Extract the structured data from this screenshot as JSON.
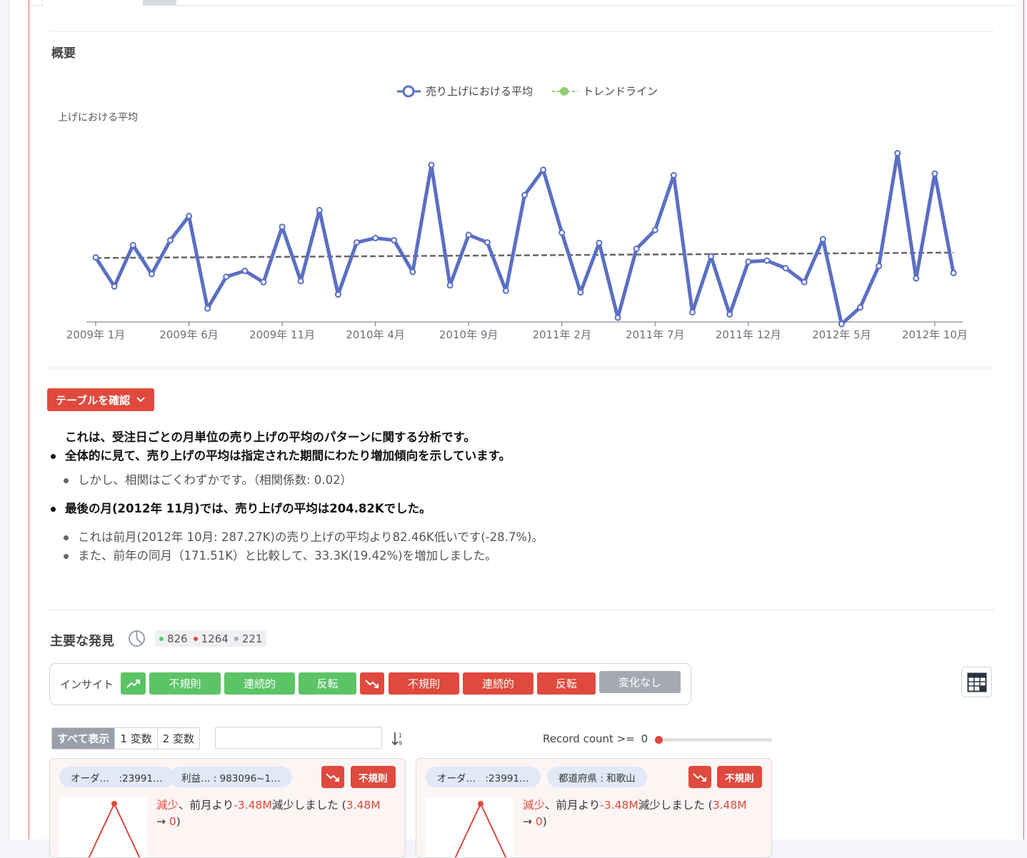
{
  "overview": {
    "title": "概要",
    "view_table_button": "テーブルを確認"
  },
  "chart_data": {
    "type": "line",
    "title": "",
    "ylabel": "売り上げにおける平均",
    "ylabel_visible": "上げにおける平均",
    "xlabel": "",
    "legend": {
      "placement": "top-center",
      "items": [
        "売り上げにおける平均",
        "トレンドライン"
      ]
    },
    "colors": {
      "series": "#5b6fc4",
      "trend": "#666666",
      "trend_legend": "#91cc75"
    },
    "x_tick_labels": [
      "2009年 1月",
      "2009年 6月",
      "2009年 11月",
      "2010年 4月",
      "2010年 9月",
      "2011年 2月",
      "2011年 7月",
      "2011年 12月",
      "2012年 5月",
      "2012年 10月"
    ],
    "x": [
      "2009-01",
      "2009-02",
      "2009-03",
      "2009-04",
      "2009-05",
      "2009-06",
      "2009-07",
      "2009-08",
      "2009-09",
      "2009-10",
      "2009-11",
      "2009-12",
      "2010-01",
      "2010-02",
      "2010-03",
      "2010-04",
      "2010-05",
      "2010-06",
      "2010-07",
      "2010-08",
      "2010-09",
      "2010-10",
      "2010-11",
      "2010-12",
      "2011-01",
      "2011-02",
      "2011-03",
      "2011-04",
      "2011-05",
      "2011-06",
      "2011-07",
      "2011-08",
      "2011-09",
      "2011-10",
      "2011-11",
      "2011-12",
      "2012-01",
      "2012-02",
      "2012-03",
      "2012-04",
      "2012-05",
      "2012-06",
      "2012-07",
      "2012-08",
      "2012-09",
      "2012-10",
      "2012-11"
    ],
    "ylim": [
      0,
      340
    ],
    "grid": false,
    "series": [
      {
        "name": "売り上げにおける平均",
        "values": [
          120,
          66,
          143,
          89,
          152,
          197,
          25,
          84,
          95,
          74,
          177,
          76,
          208,
          51,
          148,
          156,
          152,
          93,
          292,
          68,
          162,
          148,
          58,
          236,
          283,
          166,
          55,
          147,
          8,
          136,
          171,
          273,
          18,
          122,
          14,
          112,
          114,
          100,
          74,
          154,
          -4,
          27,
          104,
          314,
          81,
          276,
          91
        ]
      },
      {
        "name": "トレンドライン",
        "values": [
          119,
          129
        ]
      }
    ]
  },
  "summary": {
    "intro": "これは、受注日ごとの月単位の売り上げの平均のパターンに関する分析です。",
    "point1": "全体的に見て、売り上げの平均は指定された期間にわたり増加傾向を示しています。",
    "point1_sub": "しかし、相関はごくわずかです。（相関係数: 0.02）",
    "point2": "最後の月(2012年 11月)では、売り上げの平均は204.82Kでした。",
    "point2_sub1": "これは前月(2012年 10月: 287.27K)の売り上げの平均より82.46K低いです(-28.7%)。",
    "point2_sub2": "また、前年の同月（171.51K）と比較して、33.3K(19.42%)を増加しました。"
  },
  "findings": {
    "title": "主要な発見",
    "count_positive": "826",
    "count_negative": "1264",
    "count_neutral": "221",
    "color_positive": "#5cc466",
    "color_negative": "#e0493d",
    "color_neutral": "#a4a9b2"
  },
  "insight": {
    "label": "インサイト",
    "up_irregular": "不規則",
    "up_continuous": "連続的",
    "up_reversal": "反転",
    "down_irregular": "不規則",
    "down_continuous": "連続的",
    "down_reversal": "反転",
    "no_change": "変化なし"
  },
  "filters": {
    "show_all": "すべて表示",
    "one_var": "1 変数",
    "two_var": "2 変数",
    "search_value": "",
    "record_label": "Record count >= ",
    "record_value": "0"
  },
  "cards": [
    {
      "pill1": "オーダ…　:23991…",
      "pill2": "利益… : 983096~1…",
      "badge": "不規則",
      "t_decrease": "減少",
      "t_mid": "、前月より",
      "t_amount": "-3.48M",
      "t_after": "減少しました (",
      "t_from": "3.48M",
      "t_arrow": "→ ",
      "t_to": "0",
      "t_close": ")"
    },
    {
      "pill1": "オーダ…　:23991…",
      "pill2": "都道府県 : 和歌山",
      "badge": "不規則",
      "t_decrease": "減少",
      "t_mid": "、前月より",
      "t_amount": "-3.48M",
      "t_after": "減少しました (",
      "t_from": "3.48M",
      "t_arrow": "→ ",
      "t_to": "0",
      "t_close": ")"
    }
  ]
}
